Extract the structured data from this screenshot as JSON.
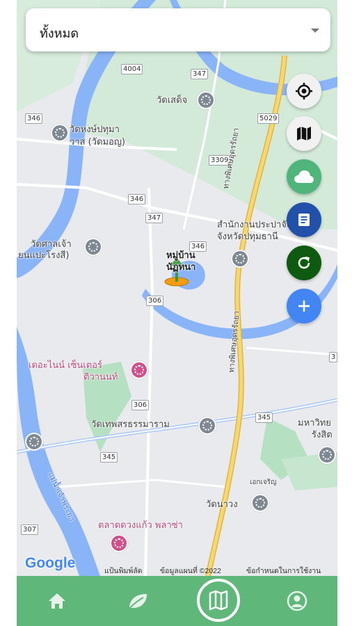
{
  "filter": {
    "selected": "ทั้งหมด"
  },
  "map": {
    "places": {
      "wat_sadet": "วัดเสด็จ",
      "wat_hong_line1": "วัดหงษ์ปทุมา",
      "wat_hong_line2": "วาส (วัดมอญ)",
      "wat_sala_line1": "วัดศาลเจ้า",
      "wat_sala_line2": "ยนแปะโรงสี)",
      "village_line1": "หมู่บ้าน",
      "village_line2": "นัฏทนา",
      "office_line1": "สำนักงานประปาจังหวัด",
      "office_line2": "จังหวัดปทุมธานี",
      "mall_line1": "เดอะไนน์ เซ็นเตอร์",
      "mall_line2": "ติวานนท์",
      "wat_thep": "วัดเทพสรธรรมาราม",
      "university_line1": "มหาวิทย",
      "university_line2": "รังสิต",
      "soi_ekchai": "เอกเจริญ",
      "wat_nang": "วัดนาวง",
      "market": "ตลาดดวงแก้ว พลาซ่า",
      "highway_name1": "ทางพิเศษอุดรรัถยา",
      "highway_name2": "ทางพิเศษอุดรรัถยา",
      "river_name": "แม่น้ำเจ้าพระยา"
    },
    "shields": {
      "r4004": "4004",
      "r347a": "347",
      "r346a": "346",
      "r5029": "5029",
      "r3309": "3309",
      "r346b": "346",
      "r347b": "347",
      "r346c": "346",
      "r306a": "306",
      "r306b": "306",
      "r345a": "345",
      "r345b": "345",
      "r307": "307",
      "r3": "3"
    },
    "google": "Google",
    "attribution": {
      "shortcuts": "แป้นพิมพ์ลัด",
      "data": "ข้อมูลแผนที่ ©2022",
      "terms": "ข้อกำหนดในการใช้งาน"
    }
  },
  "fabs": [
    {
      "name": "my-location",
      "color": "#f1f1f1"
    },
    {
      "name": "map-type",
      "color": "#f1f1f1"
    },
    {
      "name": "weather",
      "color": "#4fb57a"
    },
    {
      "name": "report",
      "color": "#2151a8"
    },
    {
      "name": "refresh",
      "color": "#0d5a10"
    },
    {
      "name": "add",
      "color": "#4286f4"
    }
  ],
  "nav": [
    "home-icon",
    "leaf-icon",
    "map-icon",
    "profile-icon"
  ],
  "colors": {
    "nav_green": "#5fb77a",
    "road_yellow": "#f2c94c",
    "water": "#8ab4f8",
    "park": "#c6e6cf"
  }
}
